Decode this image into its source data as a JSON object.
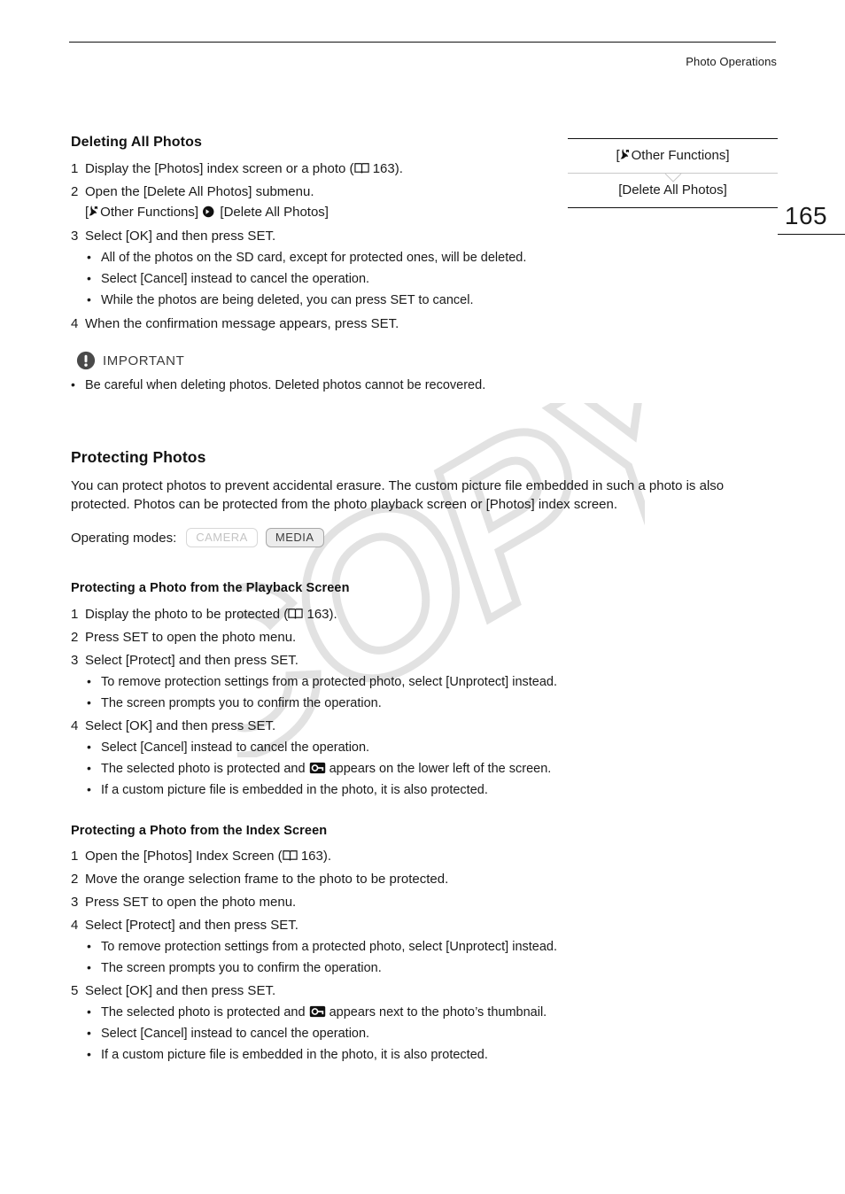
{
  "header": {
    "running_head": "Photo Operations",
    "page_number": "165"
  },
  "callout": {
    "row1": "Other Functions]",
    "row1_prefix": "[",
    "row2": "[Delete All Photos]"
  },
  "sections": {
    "deleting": {
      "heading": "Deleting All Photos",
      "steps": [
        {
          "num": "1",
          "text_before": "Display the [Photos] index screen or a photo (",
          "page_ref": "163",
          "text_after": ")."
        },
        {
          "num": "2",
          "text": "Open the [Delete All Photos] submenu."
        }
      ],
      "menu_path": {
        "open_bracket": "[",
        "first": "Other Functions]",
        "second": "[Delete All Photos]"
      },
      "step3": {
        "num": "3",
        "text": "Select [OK] and then press SET."
      },
      "bullets": [
        "All of the photos on the SD card, except for protected ones, will be deleted.",
        "Select [Cancel] instead to cancel the operation.",
        "While the photos are being deleted, you can press SET to cancel."
      ],
      "step4": {
        "num": "4",
        "text": "When the confirmation message appears, press SET."
      },
      "important": {
        "label": "IMPORTANT",
        "bullet": "Be careful when deleting photos. Deleted photos cannot be recovered."
      }
    },
    "protecting": {
      "heading": "Protecting Photos",
      "intro_line1": "You can protect photos to prevent accidental erasure. The custom picture file embedded in such a photo is also",
      "intro_line2": "protected. Photos can be protected from the photo playback screen or [Photos] index screen.",
      "operating_modes_label": "Operating modes:",
      "modes": [
        {
          "label": "CAMERA",
          "state": "off"
        },
        {
          "label": "MEDIA",
          "state": "on"
        }
      ]
    },
    "playback": {
      "heading": "Protecting a Photo from the Playback Screen",
      "step1": {
        "num": "1",
        "text_before": "Display the photo to be protected (",
        "page_ref": "163",
        "text_after": ")."
      },
      "step2": {
        "num": "2",
        "text": "Press SET to open the photo menu."
      },
      "step3": {
        "num": "3",
        "text": "Select [Protect] and then press SET."
      },
      "step3_bullets": [
        "To remove protection settings from a protected photo, select [Unprotect] instead.",
        "The screen prompts you to confirm the operation."
      ],
      "step4": {
        "num": "4",
        "text": "Select [OK] and then press SET."
      },
      "step4_bullets": [
        {
          "text": "Select [Cancel] instead to cancel the operation."
        },
        {
          "text_before": "The selected photo is protected and ",
          "icon": "key-icon",
          "text_after": " appears on the lower left of the screen."
        },
        {
          "text": "If a custom picture file is embedded in the photo, it is also protected."
        }
      ]
    },
    "index": {
      "heading": "Protecting a Photo from the Index Screen",
      "step1": {
        "num": "1",
        "text_before": "Open the [Photos] Index Screen (",
        "page_ref": "163",
        "text_after": ")."
      },
      "step2": {
        "num": "2",
        "text": "Move the orange selection frame to the photo to be protected."
      },
      "step3": {
        "num": "3",
        "text": "Press SET to open the photo menu."
      },
      "step4": {
        "num": "4",
        "text": "Select [Protect] and then press SET."
      },
      "step4_bullets": [
        "To remove protection settings from a protected photo, select [Unprotect] instead.",
        "The screen prompts you to confirm the operation."
      ],
      "step5": {
        "num": "5",
        "text": "Select [OK] and then press SET."
      },
      "step5_bullets": [
        {
          "text_before": "The selected photo is protected and ",
          "icon": "key-icon",
          "text_after": " appears next to the photo’s thumbnail."
        },
        {
          "text": "Select [Cancel] instead to cancel the operation."
        },
        {
          "text": "If a custom picture file is embedded in the photo, it is also protected."
        }
      ]
    }
  },
  "watermark": {
    "text": "COPY"
  },
  "colors": {
    "text": "#1a1a1a",
    "rule": "#111111",
    "light_rule": "#c9c9c9",
    "watermark": "#e2e2e2",
    "chip_off_text": "#c4c4c4",
    "chip_on_bg": "#ececec"
  }
}
